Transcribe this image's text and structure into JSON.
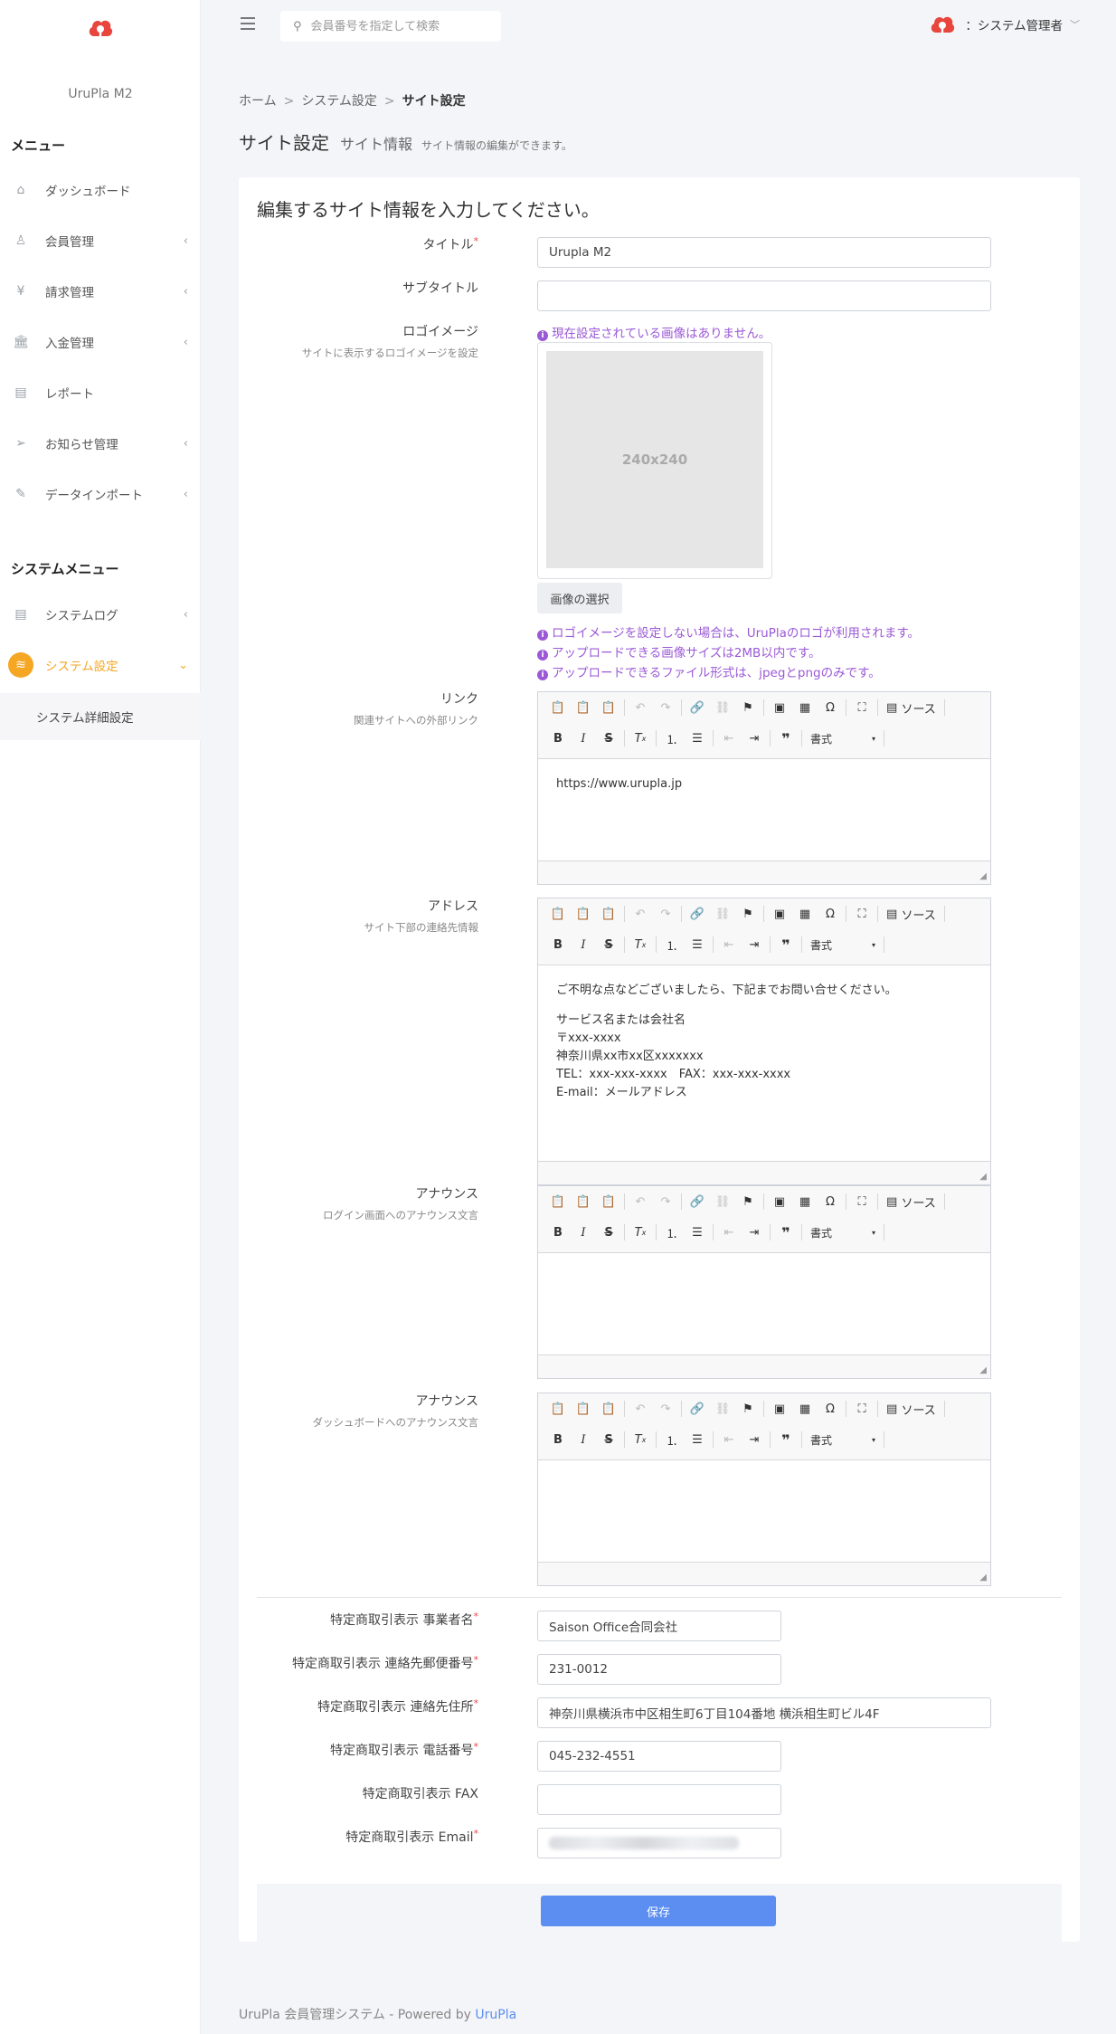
{
  "app": {
    "name": "UruPla M2",
    "user": "：システム管理者"
  },
  "search": {
    "placeholder": "会員番号を指定して検索"
  },
  "sidebar": {
    "menu_heading": "メニュー",
    "items": [
      {
        "label": "ダッシュボード",
        "icon": "home-icon"
      },
      {
        "label": "会員管理",
        "icon": "user-icon"
      },
      {
        "label": "請求管理",
        "icon": "yen-icon"
      },
      {
        "label": "入金管理",
        "icon": "bank-icon"
      },
      {
        "label": "レポート",
        "icon": "document-icon"
      },
      {
        "label": "お知らせ管理",
        "icon": "paper-plane-icon"
      },
      {
        "label": "データインポート",
        "icon": "edit-icon"
      }
    ],
    "system_heading": "システムメニュー",
    "system_items": [
      {
        "label": "システムログ",
        "icon": "document-icon"
      },
      {
        "label": "システム設定",
        "icon": "layers-icon"
      }
    ],
    "sub_item": "システム詳細設定"
  },
  "breadcrumb": {
    "home": "ホーム",
    "parent": "システム設定",
    "current": "サイト設定"
  },
  "page": {
    "title": "サイト設定",
    "subtitle": "サイト情報",
    "description": "サイト情報の編集ができます。"
  },
  "form": {
    "heading": "編集するサイト情報を入力してください。",
    "title_label": "タイトル",
    "title_value": "Urupla M2",
    "subtitle_label": "サブタイトル",
    "subtitle_value": "",
    "logo_label": "ロゴイメージ",
    "logo_hint": "サイトに表示するロゴイメージを設定",
    "logo_none": "現在設定されている画像はありません。",
    "logo_placeholder": "240x240",
    "logo_button": "画像の選択",
    "logo_notes": [
      "ロゴイメージを設定しない場合は、UruPlaのロゴが利用されます。",
      "アップロードできる画像サイズは2MB以内です。",
      "アップロードできるファイル形式は、jpegとpngのみです。"
    ],
    "link_label": "リンク",
    "link_hint": "関連サイトへの外部リンク",
    "link_body": [
      "https://www.urupla.jp"
    ],
    "address_label": "アドレス",
    "address_hint": "サイト下部の連絡先情報",
    "address_body": [
      "ご不明な点などございましたら、下記までお問い合せください。",
      "サービス名または会社名",
      "〒xxx-xxxx",
      "神奈川県xx市xx区xxxxxxx",
      "TEL：xxx-xxx-xxxx　FAX：xxx-xxx-xxxx",
      "E-mail：メールアドレス"
    ],
    "announce1_label": "アナウンス",
    "announce1_hint": "ログイン画面へのアナウンス文言",
    "announce2_label": "アナウンス",
    "announce2_hint": "ダッシュボードへのアナウンス文言",
    "biz_name_label": "特定商取引表示 事業者名",
    "biz_name_value": "Saison Office合同会社",
    "zip_label": "特定商取引表示 連絡先郵便番号",
    "zip_value": "231-0012",
    "addr_label": "特定商取引表示 連絡先住所",
    "addr_value": "神奈川県横浜市中区相生町6丁目104番地 横浜相生町ビル4F",
    "tel_label": "特定商取引表示 電話番号",
    "tel_value": "045-232-4551",
    "fax_label": "特定商取引表示 FAX",
    "fax_value": "",
    "email_label": "特定商取引表示 Email",
    "save_label": "保存"
  },
  "editor": {
    "source_label": "ソース",
    "format_label": "書式"
  },
  "footer": {
    "text": "UruPla 会員管理システム - Powered by ",
    "link": "UruPla"
  },
  "colors": {
    "accent": "#f5a623",
    "primary": "#5b8ef0",
    "info": "#9b59d6",
    "required": "#e84a4a"
  }
}
